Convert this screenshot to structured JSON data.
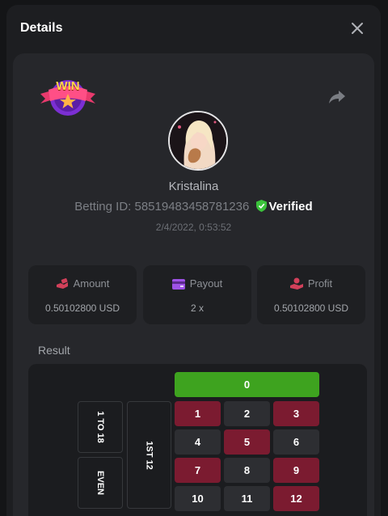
{
  "modal": {
    "title": "Details",
    "share_icon": "share-arrow-icon",
    "close_icon": "close-icon",
    "badge": {
      "text": "WIN",
      "icon": "star-icon"
    }
  },
  "player": {
    "name": "Kristalina",
    "betting_id_label": "Betting ID:",
    "betting_id": "58519483458781236",
    "verified_label": "Verified",
    "date": "2/4/2022, 0:53:52"
  },
  "stats": [
    {
      "label": "Amount",
      "value": "0.50102800 USD",
      "icon": "money-hand-icon",
      "icon_color": "#d2405a"
    },
    {
      "label": "Payout",
      "value": "2 x",
      "icon": "wallet-card-icon",
      "icon_color": "#9e52e6"
    },
    {
      "label": "Profit",
      "value": "0.50102800 USD",
      "icon": "hand-coin-icon",
      "icon_color": "#d2405a"
    }
  ],
  "result": {
    "label": "Result",
    "zero": "0",
    "side_bets": [
      "1 TO 18",
      "EVEN"
    ],
    "dozen": "1ST 12",
    "numbers": [
      {
        "n": "1",
        "color": "red"
      },
      {
        "n": "2",
        "color": "black"
      },
      {
        "n": "3",
        "color": "red"
      },
      {
        "n": "4",
        "color": "black"
      },
      {
        "n": "5",
        "color": "red"
      },
      {
        "n": "6",
        "color": "black"
      },
      {
        "n": "7",
        "color": "red"
      },
      {
        "n": "8",
        "color": "black"
      },
      {
        "n": "9",
        "color": "red"
      },
      {
        "n": "10",
        "color": "black"
      },
      {
        "n": "11",
        "color": "black"
      },
      {
        "n": "12",
        "color": "red"
      }
    ]
  },
  "colors": {
    "green": "#3ea31f",
    "red": "#7b1b30",
    "black": "#2d2e32",
    "verified": "#3bc23b"
  }
}
